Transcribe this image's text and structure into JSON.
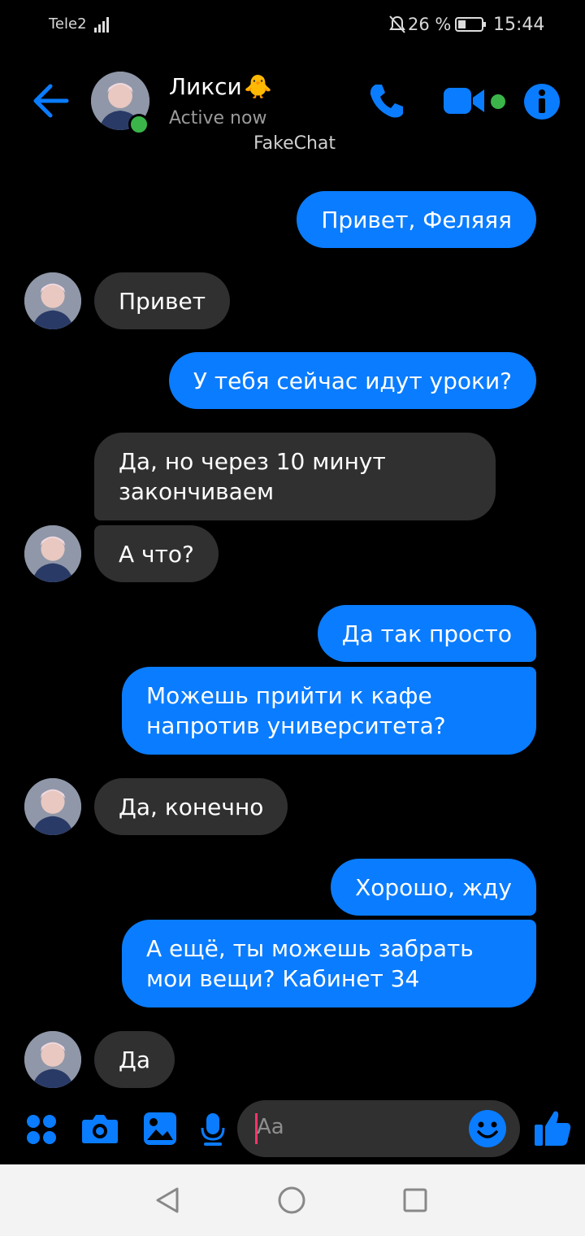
{
  "status_bar": {
    "carrier": "Tele2",
    "battery": "26 %",
    "time": "15:44"
  },
  "header": {
    "contact_name": "Ликси",
    "contact_emoji": "🐥",
    "status": "Active now",
    "watermark": "FakeChat",
    "icons": [
      "back-arrow-icon",
      "phone-icon",
      "video-camera-icon",
      "info-icon"
    ]
  },
  "messages": [
    {
      "dir": "out",
      "text": "Привет, Феляяя"
    },
    {
      "dir": "in",
      "text": "Привет"
    },
    {
      "dir": "out",
      "text": "У тебя сейчас идут уроки?"
    },
    {
      "dir": "in",
      "text": "Да, но через 10 минут\nзакончиваем"
    },
    {
      "dir": "in",
      "text": "А что?"
    },
    {
      "dir": "out",
      "text": "Да так просто"
    },
    {
      "dir": "out",
      "text": "Можешь прийти к кафе\nнапротив университета?"
    },
    {
      "dir": "in",
      "text": "Да, конечно"
    },
    {
      "dir": "out",
      "text": "Хорошо, жду"
    },
    {
      "dir": "out",
      "text": "А ещё, ты можешь забрать\nмои вещи? Кабинет 34"
    },
    {
      "dir": "in",
      "text": "Да"
    }
  ],
  "composer": {
    "placeholder": "Aa",
    "icons": [
      "apps-icon",
      "camera-icon",
      "gallery-icon",
      "microphone-icon",
      "emoji-icon",
      "thumbs-up-icon"
    ]
  },
  "colors": {
    "accent": "#0a7cff",
    "incoming_bubble": "#303030",
    "background": "#000000",
    "online": "#3bb54a"
  }
}
